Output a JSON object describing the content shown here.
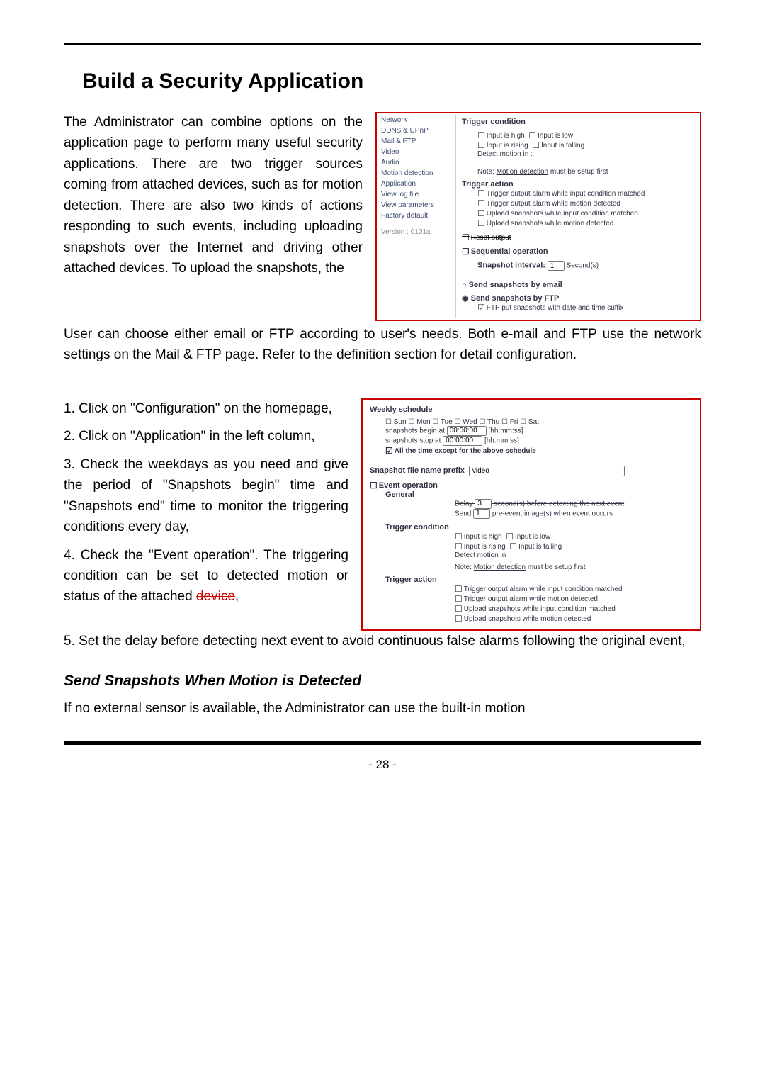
{
  "heading": "Build a Security Application",
  "intro_left": "The Administrator can combine options on the application page to perform many useful security applications. There are two trigger sources coming from attached devices, such as for motion detection. There are also two kinds of actions responding to such events, including uploading snapshots over the Internet and driving other attached devices. To upload the snapshots, the",
  "intro_rest": "User can choose either email or FTP according to user's needs. Both e-mail and FTP use the network settings on the Mail & FTP page. Refer to the definition section for detail configuration.",
  "step1": "1. Click on \"Configuration\" on the homepage,",
  "step2": "2. Click on \"Application\" in the left column,",
  "step3": "3. Check the weekdays as you need and give the period of \"Snapshots begin\" time and \"Snapshots end\" time to monitor the triggering conditions every day,",
  "step4a": "4. Check the \"Event operation\". The triggering condition can be set to detected motion or status of the attached ",
  "step4b_struck": "device",
  "step4c": ",",
  "step5": "5. Set the delay before detecting next event to avoid continuous false alarms following the original event,",
  "sub_heading": "Send Snapshots When Motion is Detected",
  "sub_body": "If no external sensor is available, the Administrator can use the built-in motion",
  "page_number": "- 28 -",
  "fig1": {
    "nav": [
      "Network",
      "DDNS & UPnP",
      "Mail & FTP",
      "Video",
      "Audio",
      "Motion detection",
      "Application",
      "View log file",
      "View parameters",
      "Factory default"
    ],
    "version": "Version : 0101a",
    "h_trigger_cond": "Trigger condition",
    "c_in_high": "Input is high",
    "c_in_low": "Input is low",
    "c_in_rise": "Input is rising",
    "c_in_fall": "Input is falling",
    "detect": "Detect motion in :",
    "note_pre": "Note: ",
    "note_link": "Motion detection",
    "note_post": " must be setup first",
    "h_trigger_act": "Trigger action",
    "a1": "Trigger output alarm while input condition matched",
    "a2": "Trigger output alarm while motion detected",
    "a3": "Upload snapshots while input condition matched",
    "a4": "Upload snapshots while motion detected",
    "reset": "Reset output",
    "seq": "Sequential operation",
    "snap_int": "Snapshot interval:",
    "snap_int_v": "1",
    "seconds": "Second(s)",
    "by_email": "Send snapshots by email",
    "by_ftp": "Send snapshots by FTP",
    "suffix": "FTP put snapshots with date and time suffix"
  },
  "fig2": {
    "ws": "Weekly schedule",
    "days": "Sun  ☐ Mon  ☐ Tue  ☐ Wed  ☐ Thu  ☐ Fri  ☐ Sat",
    "begin_l": "snapshots begin at",
    "begin_v": "00:00:00",
    "hhmmss": "[hh:mm:ss]",
    "stop_l": "snapshots stop at",
    "stop_v": "00:00:00",
    "except": "All the time except for the above schedule",
    "prefix_l": "Snapshot file name prefix",
    "prefix_v": "video",
    "ev_op": "Event operation",
    "general": "General",
    "delay_l": "Delay",
    "delay_v": "3",
    "delay_post": "second(s) before detecting the next event",
    "send_l": "Send",
    "send_v": "1",
    "send_post": "pre-event image(s) when event occurs",
    "tc": "Trigger condition",
    "c_in_high": "Input is high",
    "c_in_low": "Input is low",
    "c_in_rise": "Input is rising",
    "c_in_fall": "Input is falling",
    "detect": "Detect motion in :",
    "note_pre": "Note: ",
    "note_link": "Motion detection",
    "note_post": " must be setup first",
    "ta": "Trigger action",
    "a1": "Trigger output alarm while input condition matched",
    "a2": "Trigger output alarm while motion detected",
    "a3": "Upload snapshots while input condition matched",
    "a4": "Upload snapshots while motion detected"
  }
}
